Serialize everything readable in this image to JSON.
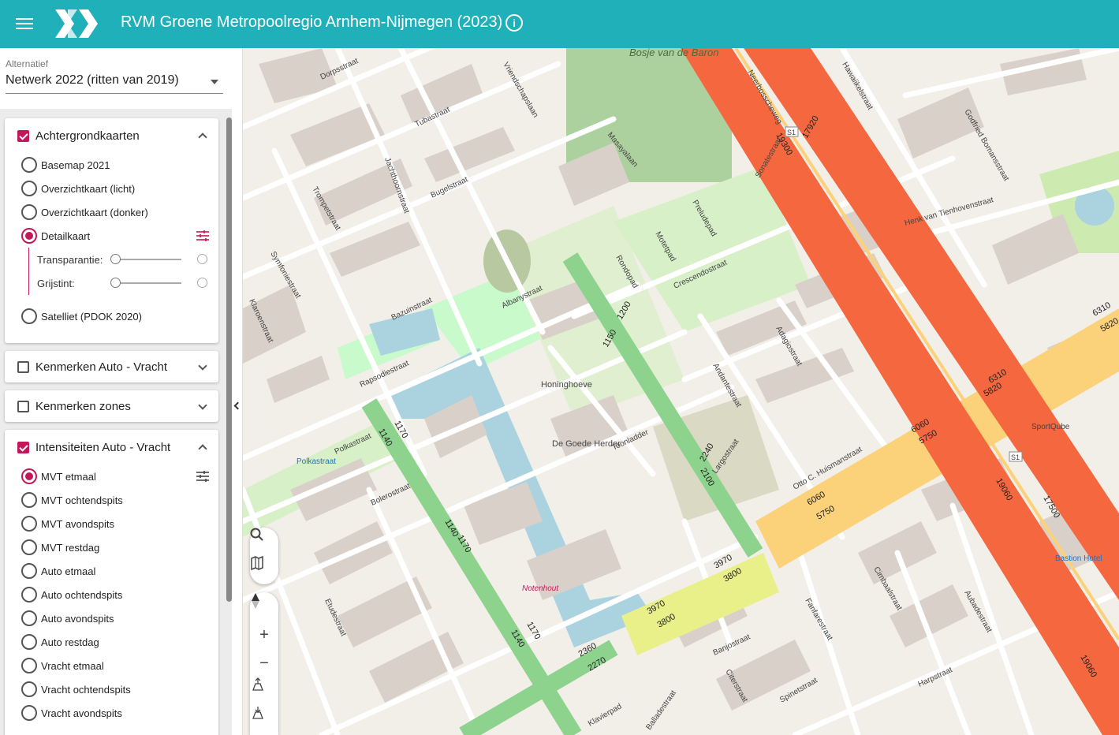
{
  "header": {
    "title": "RVM Groene Metropoolregio Arnhem-Nijmegen (2023)"
  },
  "alternative": {
    "label": "Alternatief",
    "value": "Netwerk 2022 (ritten van 2019)"
  },
  "panels": {
    "background": {
      "title": "Achtergrondkaarten",
      "checked": true,
      "options": [
        "Basemap 2021",
        "Overzichtkaart (licht)",
        "Overzichtkaart (donker)",
        "Detailkaart",
        "Satelliet (PDOK 2020)"
      ],
      "selected": "Detailkaart",
      "transparency_label": "Transparantie:",
      "grayscale_label": "Grijstint:"
    },
    "truck_features": {
      "title": "Kenmerken Auto - Vracht",
      "checked": false
    },
    "zone_features": {
      "title": "Kenmerken zones",
      "checked": false
    },
    "intensities": {
      "title": "Intensiteiten Auto - Vracht",
      "checked": true,
      "options": [
        "MVT etmaal",
        "MVT ochtendspits",
        "MVT avondspits",
        "MVT restdag",
        "Auto etmaal",
        "Auto ochtendspits",
        "Auto avondspits",
        "Auto restdag",
        "Vracht etmaal",
        "Vracht ochtendspits",
        "Vracht avondspits"
      ],
      "selected": "MVT etmaal"
    }
  },
  "map": {
    "street_labels": [
      "Dorpsstraat",
      "Vriendschapslaan",
      "Tubastraat",
      "Jachthoornstraat",
      "Bugelstraat",
      "Masayalaan",
      "Trompetstraat",
      "Symfoniestraat",
      "Klaroenstraat",
      "Bazuinstraat",
      "Albanystraat",
      "Rapsodiestraat",
      "Polkastraat",
      "Bolerostraat",
      "Etudestraat",
      "Rondopad",
      "Motetpad",
      "Preludepad",
      "Crescendostraat",
      "Sonatestraat",
      "Adagiostraat",
      "Andantestraat",
      "Toonladder",
      "Otto C. Huismanstraat",
      "Neerbosscheweg",
      "Henk van Tienhovenstraat",
      "Godfried Bomansstraat",
      "Hawaiikelstraat",
      "Cimbaalstraat",
      "Aubadestraat",
      "Fanfarestraat",
      "Banjostraat",
      "Citerstraat",
      "Spinetstraat",
      "Harpstraat",
      "Klavierpad",
      "Balladestraat",
      "Largostraat"
    ],
    "place_labels": [
      "Bosje van de Baron",
      "Honinghoeve",
      "De Goede Herder",
      "Notenhout",
      "Polkastraat",
      "Bastion Hotel",
      "SportQube"
    ],
    "volume_labels": [
      "17920",
      "19300",
      "6310",
      "5820",
      "6060",
      "5750",
      "3970",
      "3800",
      "1200",
      "1150",
      "2240",
      "2100",
      "1170",
      "1140",
      "2360",
      "2270",
      "19060",
      "17500"
    ],
    "road_shields": [
      "S1",
      "S1"
    ]
  },
  "colors": {
    "header": "#1fb0b9",
    "accent": "#c2185b",
    "volume_high": "#f4673f",
    "volume_mid": "#fbd27a",
    "volume_low": "#e9f08a",
    "volume_green": "#8ed38d"
  },
  "icons": [
    "menu-icon",
    "logo-icon",
    "info-icon",
    "tune-icon",
    "search-icon",
    "map-layers-icon",
    "compass-icon",
    "zoom-in-icon",
    "zoom-out-icon",
    "tilt-up-icon",
    "tilt-down-icon",
    "collapse-left-icon"
  ]
}
